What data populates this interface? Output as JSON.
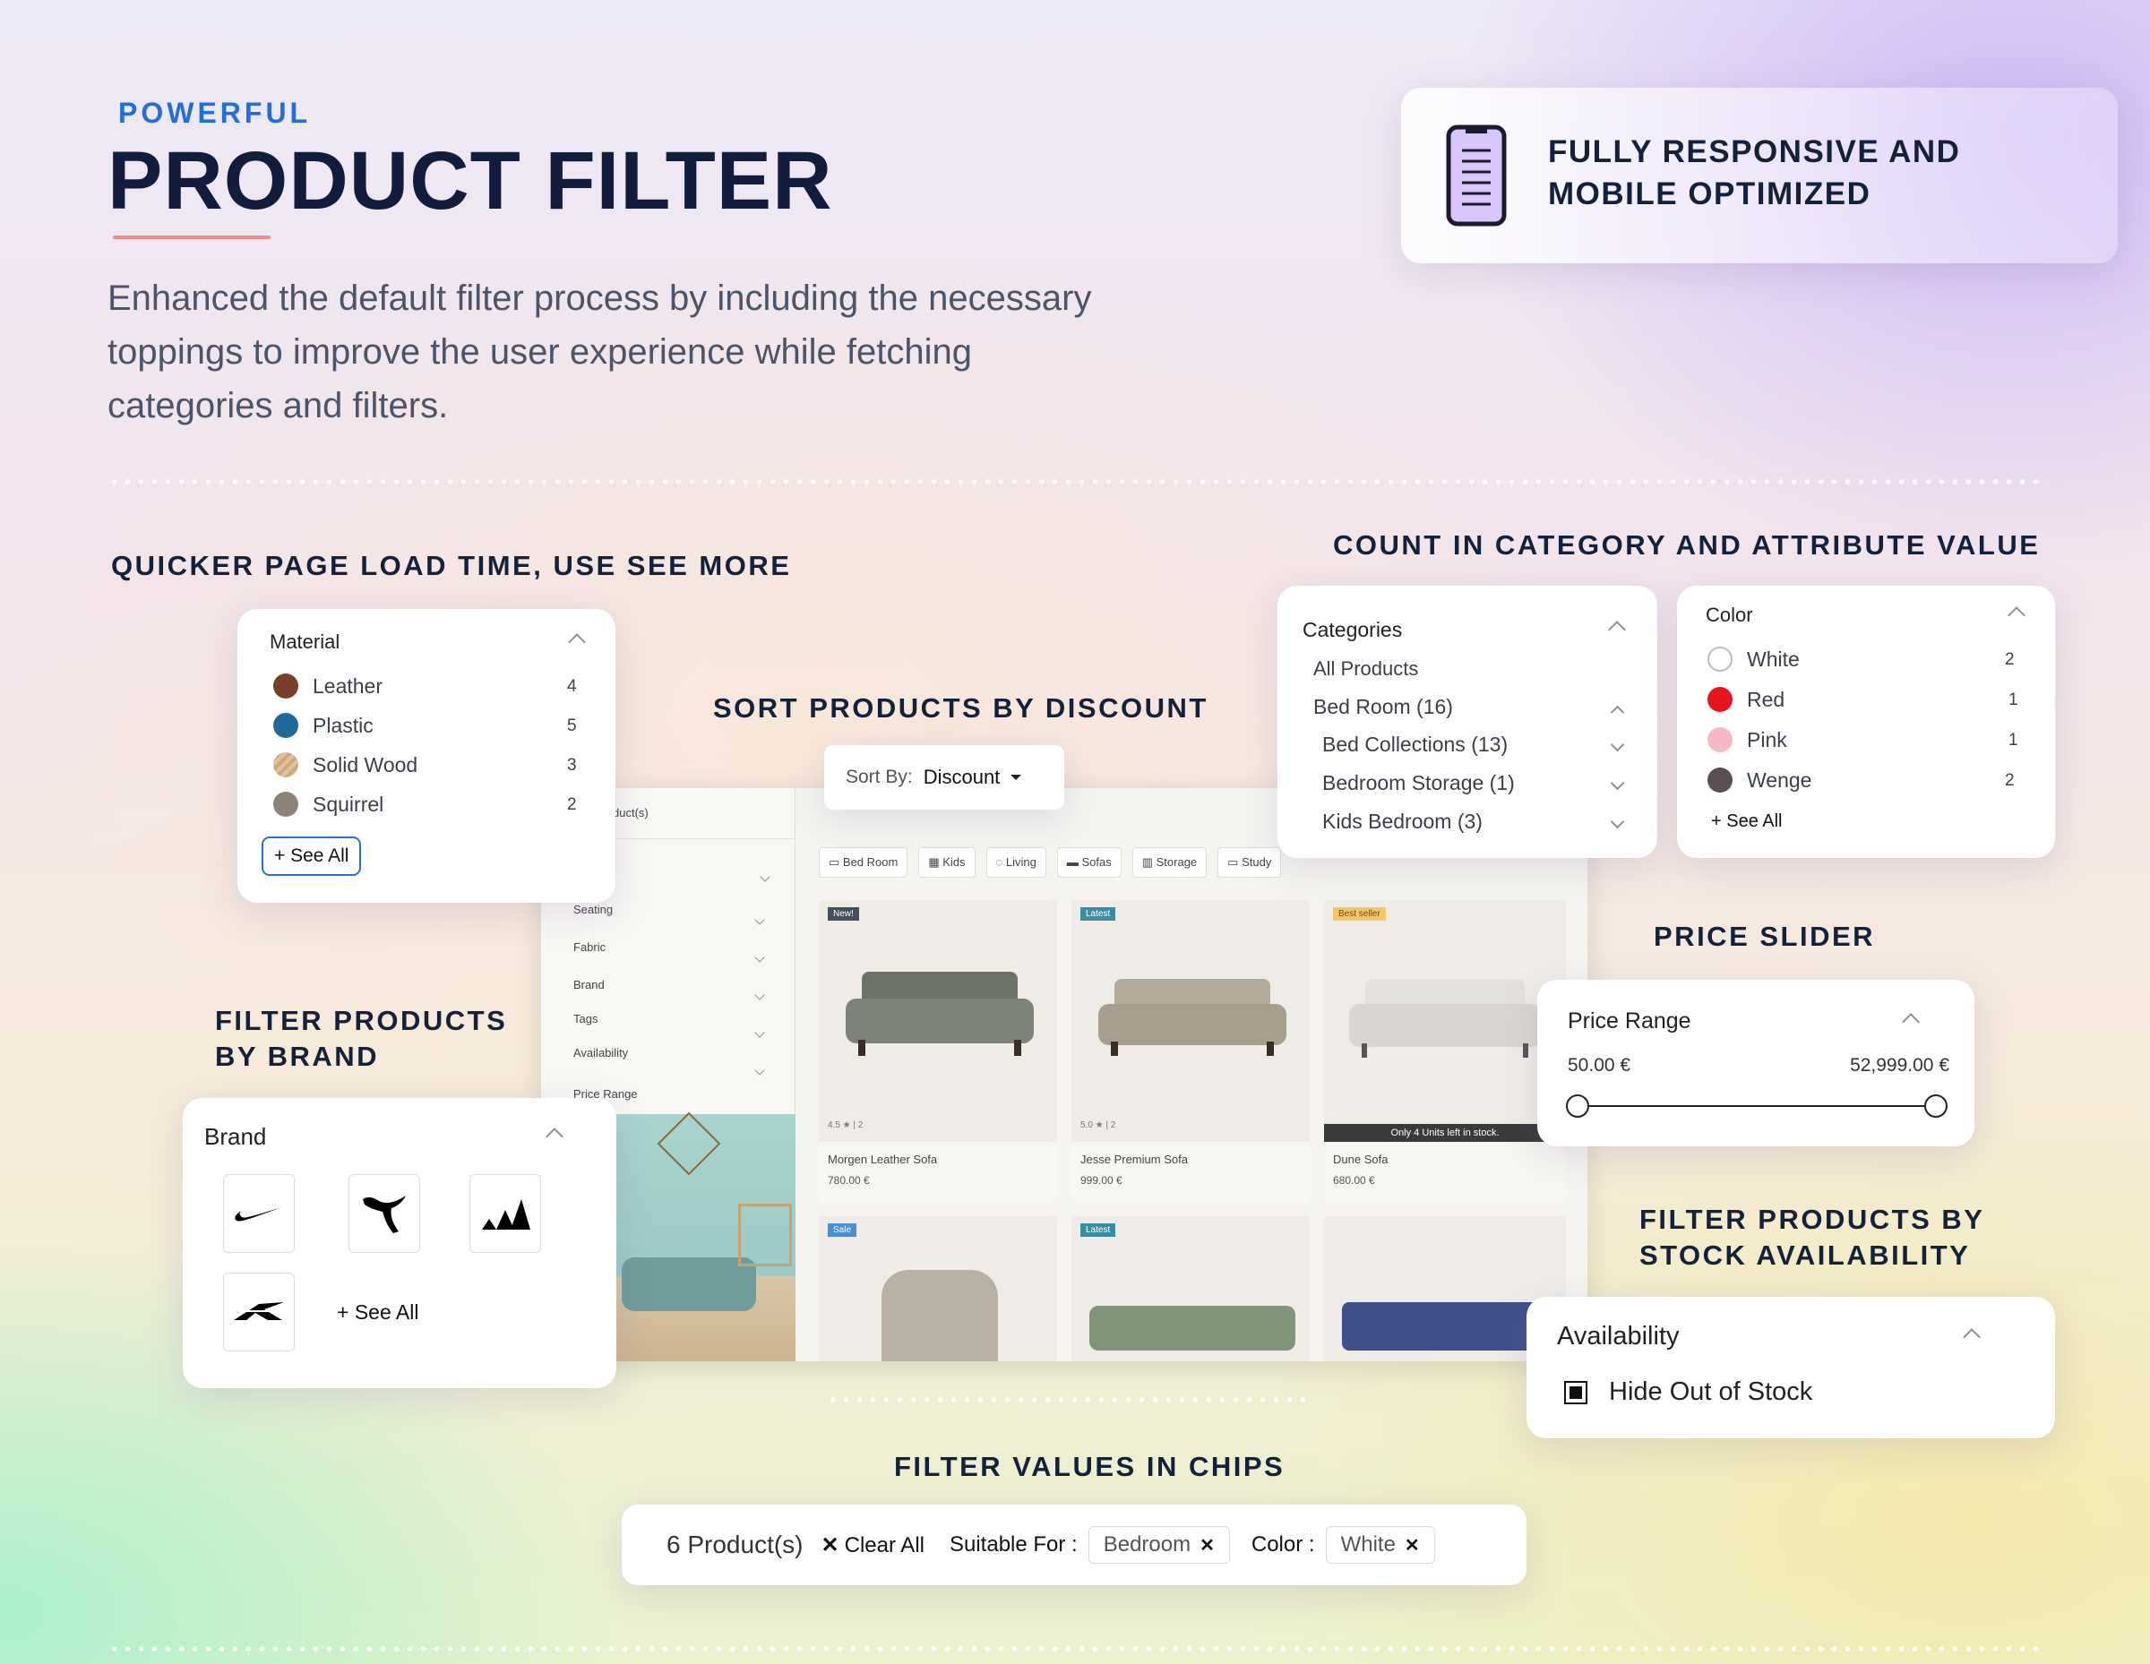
{
  "hero": {
    "eyebrow": "POWERFUL",
    "title": "PRODUCT FILTER",
    "description_lines": [
      "Enhanced the default filter process by including the necessary",
      "toppings to improve the user experience while fetching",
      "categories and filters."
    ]
  },
  "responsive_card": {
    "icon": "mobile-phone-icon",
    "line1": "FULLY RESPONSIVE AND",
    "line2": "MOBILE OPTIMIZED"
  },
  "features": {
    "see_more": "QUICKER PAGE LOAD TIME, USE SEE MORE",
    "count": "COUNT IN CATEGORY AND ATTRIBUTE VALUE",
    "sort": "SORT PRODUCTS BY DISCOUNT",
    "price": "PRICE SLIDER",
    "brand_line1": "FILTER PRODUCTS",
    "brand_line2": "BY BRAND",
    "stock_line1": "FILTER PRODUCTS BY",
    "stock_line2": "STOCK AVAILABILITY",
    "chips": "FILTER VALUES IN CHIPS"
  },
  "material": {
    "title": "Material",
    "items": [
      {
        "label": "Leather",
        "count": "4",
        "color": "#7a3f2a"
      },
      {
        "label": "Plastic",
        "count": "5",
        "color": "#1e6a99"
      },
      {
        "label": "Solid Wood",
        "count": "3",
        "color": "#d8b88e"
      },
      {
        "label": "Squirrel",
        "count": "2",
        "color": "#8b8378"
      }
    ],
    "see_all": "+ See All"
  },
  "categories": {
    "title": "Categories",
    "items": [
      "All Products",
      "Bed Room (16)",
      "Bed Collections (13)",
      "Bedroom Storage (1)",
      "Kids Bedroom (3)"
    ]
  },
  "color": {
    "title": "Color",
    "items": [
      {
        "label": "White",
        "count": "2",
        "color": "#ffffff"
      },
      {
        "label": "Red",
        "count": "1",
        "color": "#e8141b"
      },
      {
        "label": "Pink",
        "count": "1",
        "color": "#f5b8c4"
      },
      {
        "label": "Wenge",
        "count": "2",
        "color": "#5b4e52"
      }
    ],
    "see_all": "+ See All"
  },
  "sort": {
    "label": "Sort By:",
    "value": "Discount"
  },
  "price": {
    "title": "Price Range",
    "min": "50.00 €",
    "max": "52,999.00 €",
    "range_fraction": [
      0,
      1
    ]
  },
  "brand": {
    "title": "Brand",
    "logos": [
      "nike-logo",
      "puma-logo",
      "adidas-logo",
      "reebok-logo"
    ],
    "see_all": "+ See All"
  },
  "availability": {
    "title": "Availability",
    "option": "Hide Out of Stock",
    "checked": true
  },
  "chips_bar": {
    "count": "6 Product(s)",
    "clear": "Clear All",
    "suitable_label": "Suitable For :",
    "suitable_value": "Bedroom",
    "color_label": "Color :",
    "color_value": "White"
  },
  "shop": {
    "products_label": "duct(s)",
    "sidebar": [
      "Seating",
      "Fabric",
      "Brand",
      "Tags",
      "Availability",
      "Price Range"
    ],
    "tabs": [
      "Bed Room",
      "Kids",
      "Living",
      "Sofas",
      "Storage",
      "Study"
    ],
    "products": [
      {
        "badge": "New!",
        "rating": "4.5 ★ | 2",
        "name": "Morgen Leather Sofa",
        "price": "780.00 €"
      },
      {
        "badge": "Latest",
        "rating": "5.0 ★ | 2",
        "name": "Jesse Premium Sofa",
        "price": "999.00 €"
      },
      {
        "badge": "Best seller",
        "stock": "Only 4 Units left in stock.",
        "name": "Dune Sofa",
        "price": "680.00 €"
      }
    ],
    "row2_badges": [
      "Sale",
      "Latest"
    ]
  }
}
